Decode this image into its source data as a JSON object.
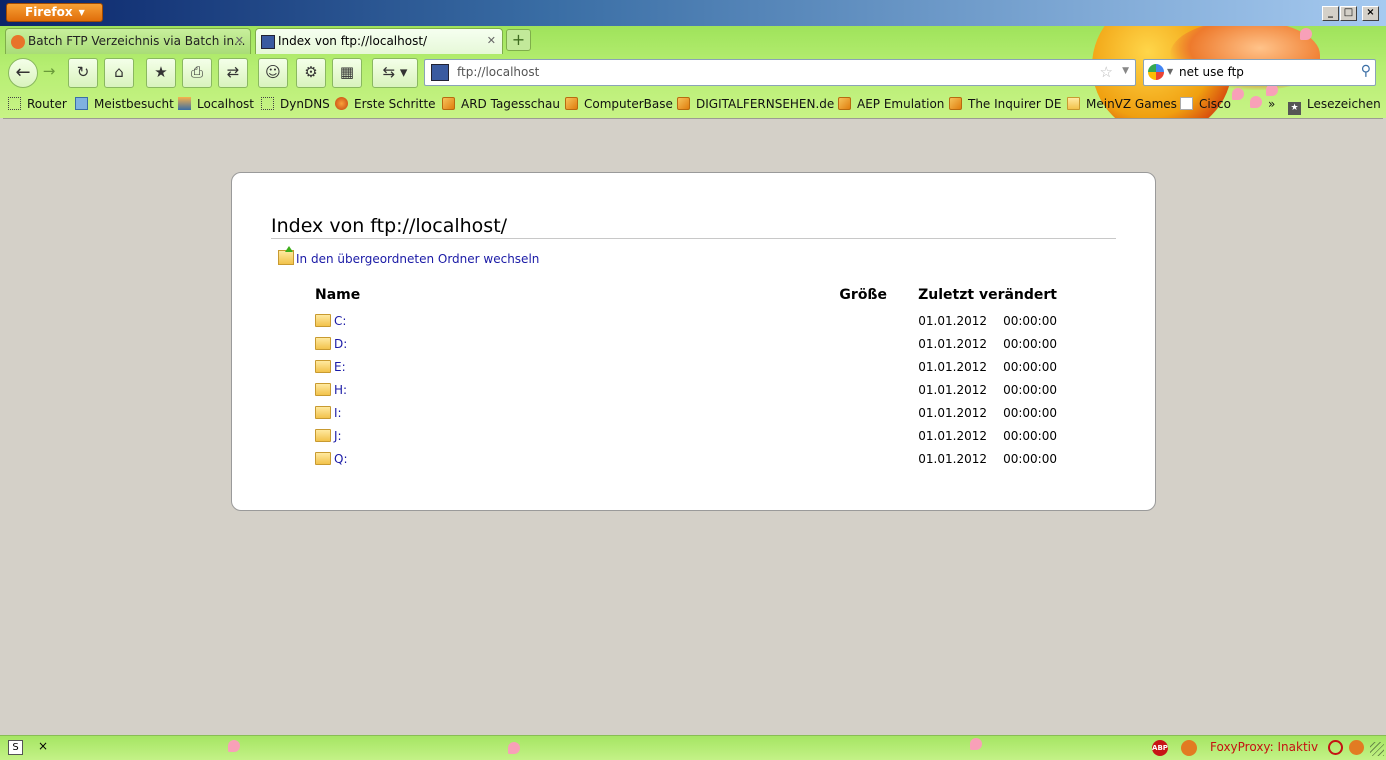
{
  "window": {
    "app_button": "Firefox",
    "minimize": "_",
    "maximize": "□",
    "close": "×"
  },
  "tabs": [
    {
      "label": "Batch FTP Verzeichnis via Batch in...",
      "active": false
    },
    {
      "label": "Index von ftp://localhost/",
      "active": true
    }
  ],
  "new_tab": "+",
  "navbar": {
    "url": "ftp://localhost",
    "search_query": "net use ftp"
  },
  "bookmarks": [
    {
      "label": "Router",
      "icon": "dotted-page-icon"
    },
    {
      "label": "Meistbesucht",
      "icon": "smart-folder-icon"
    },
    {
      "label": "Localhost",
      "icon": "pma-icon"
    },
    {
      "label": "DynDNS",
      "icon": "dotted-page-icon"
    },
    {
      "label": "Erste Schritte",
      "icon": "firefox-icon"
    },
    {
      "label": "ARD Tagesschau",
      "icon": "rss-icon"
    },
    {
      "label": "ComputerBase",
      "icon": "rss-icon"
    },
    {
      "label": "DIGITALFERNSEHEN.de",
      "icon": "rss-icon"
    },
    {
      "label": "AEP Emulation",
      "icon": "rss-icon"
    },
    {
      "label": "The Inquirer DE",
      "icon": "rss-icon"
    },
    {
      "label": "MeinVZ Games",
      "icon": "folder-icon"
    },
    {
      "label": "Cisco",
      "icon": "cisco-icon"
    }
  ],
  "bookmarks_overflow": "»",
  "bookmarks_menu": "Lesezeichen",
  "page": {
    "heading": "Index von ftp://localhost/",
    "up_link": "In den übergeordneten Ordner wechseln",
    "columns": {
      "name": "Name",
      "size": "Größe",
      "modified": "Zuletzt verändert"
    },
    "rows": [
      {
        "name": "C:",
        "size": "",
        "date": "01.01.2012",
        "time": "00:00:00"
      },
      {
        "name": "D:",
        "size": "",
        "date": "01.01.2012",
        "time": "00:00:00"
      },
      {
        "name": "E:",
        "size": "",
        "date": "01.01.2012",
        "time": "00:00:00"
      },
      {
        "name": "H:",
        "size": "",
        "date": "01.01.2012",
        "time": "00:00:00"
      },
      {
        "name": "I:",
        "size": "",
        "date": "01.01.2012",
        "time": "00:00:00"
      },
      {
        "name": "J:",
        "size": "",
        "date": "01.01.2012",
        "time": "00:00:00"
      },
      {
        "name": "Q:",
        "size": "",
        "date": "01.01.2012",
        "time": "00:00:00"
      }
    ]
  },
  "statusbar": {
    "close": "×",
    "abp": "ABP",
    "foxyproxy": "FoxyProxy: Inaktiv"
  },
  "colors": {
    "theme_green": "#a9e86a",
    "link_blue": "#1a1aa6",
    "content_bg": "#d4d0c8",
    "foxyproxy_red": "#c51212"
  }
}
